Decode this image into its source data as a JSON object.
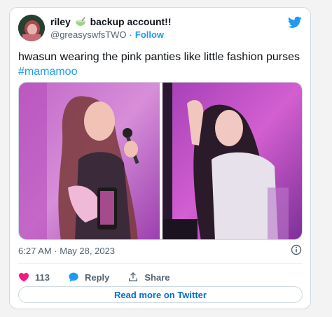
{
  "colors": {
    "accent": "#1d9bf0",
    "like_heart": "#f91880",
    "muted_text": "#536471",
    "border": "#cfd9de"
  },
  "user": {
    "display_name_part1": "riley",
    "emoji": "bowl-with-spoon-icon",
    "display_name_part2": "backup account!!",
    "handle": "@greasyswfsTWO",
    "separator": "·",
    "follow_label": "Follow"
  },
  "tweet": {
    "text": "hwasun wearing the pink panties like little fashion purses",
    "hashtag": "#mamamoo",
    "timestamp": "6:27 AM · May 28, 2023"
  },
  "media": {
    "left_photo": "performer-with-microphone",
    "right_photo": "performer-waving"
  },
  "actions": {
    "like_count": "113",
    "reply_label": "Reply",
    "share_label": "Share"
  },
  "footer": {
    "read_more_label": "Read more on Twitter"
  }
}
